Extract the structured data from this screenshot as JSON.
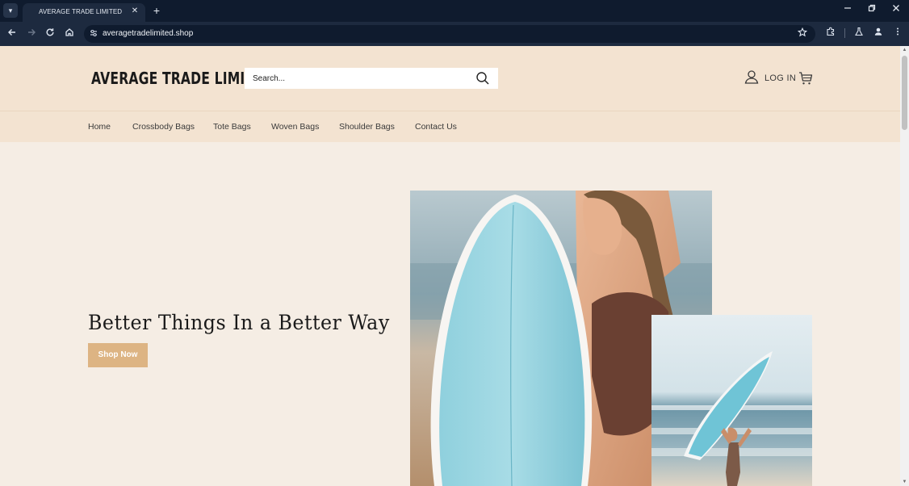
{
  "browser": {
    "tab_title": "AVERAGE TRADE LIMITED",
    "tab_close": "✕",
    "new_tab": "+",
    "url": "averagetradelimited.shop",
    "icons": [
      "back-icon",
      "forward-icon",
      "reload-icon",
      "home-icon",
      "site-info-icon",
      "star-icon",
      "extensions-icon",
      "labs-icon",
      "profile-icon",
      "menu-icon"
    ]
  },
  "header": {
    "logo": "AVERAGE TRADE LIMITED",
    "search_placeholder": "Search...",
    "login_label": "LOG IN"
  },
  "nav": {
    "items": [
      {
        "label": "Home"
      },
      {
        "label": "Crossbody Bags"
      },
      {
        "label": "Tote Bags"
      },
      {
        "label": "Woven Bags"
      },
      {
        "label": "Shoulder Bags"
      },
      {
        "label": "Contact Us"
      }
    ]
  },
  "hero": {
    "title": "Better Things In a Better Way",
    "cta": "Shop Now"
  },
  "colors": {
    "page_bg": "#f5ede4",
    "header_bg": "#f3e3d1",
    "button_bg": "#ddb483",
    "browser_dark": "#0f1b2e"
  }
}
